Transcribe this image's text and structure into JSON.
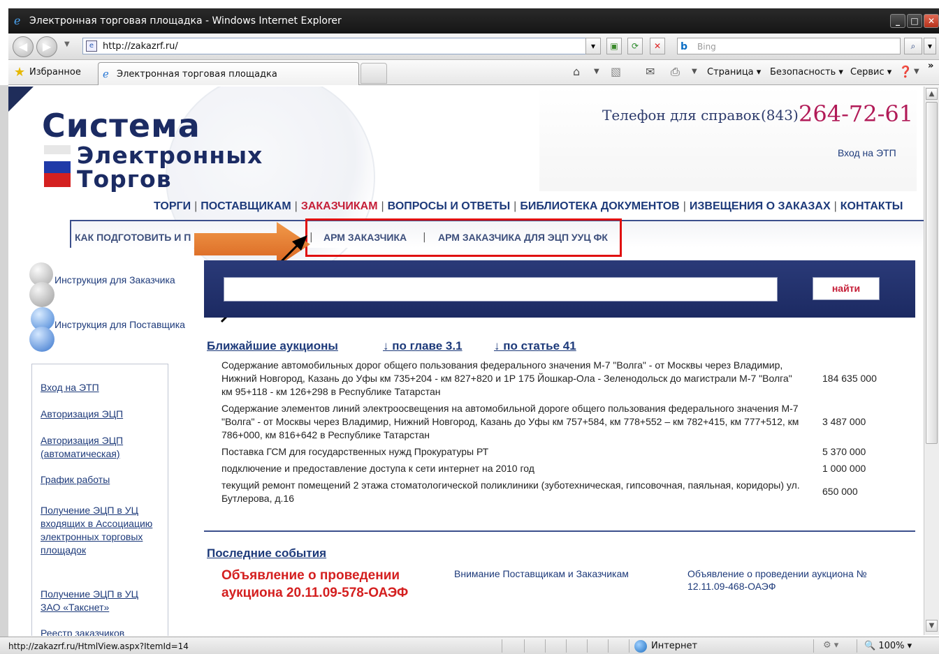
{
  "window": {
    "title": "Электронная торговая площадка - Windows Internet Explorer",
    "url": "http://zakazrf.ru/",
    "search_placeholder": "Bing",
    "search_logo": "b",
    "favorites_label": "Избранное",
    "tab_title": "Электронная торговая площадка",
    "commands": [
      "Страница",
      "Безопасность",
      "Сервис"
    ],
    "more": "»"
  },
  "header": {
    "logo_line1": "Система",
    "logo_line2": "Электронных",
    "logo_line3": "Торгов",
    "phone_label": "Телефон для справок",
    "phone_code": "(843)",
    "phone_number": "264-72-61",
    "login_link": "Вход на ЭТП"
  },
  "topnav": {
    "items": [
      "ТОРГИ",
      "ПОСТАВЩИКАМ",
      "ЗАКАЗЧИКАМ",
      "ВОПРОСЫ И ОТВЕТЫ",
      "БИБЛИОТЕКА ДОКУМЕНТОВ",
      "ИЗВЕЩЕНИЯ О ЗАКАЗАХ",
      "КОНТАКТЫ"
    ],
    "separator": "|",
    "active_index": 2
  },
  "subnav": {
    "items": [
      "КАК ПОДГОТОВИТЬ И П",
      "АРМ ЗАКАЗЧИКА",
      "АРМ ЗАКАЗЧИКА ДЛЯ ЭЦП УУЦ ФК"
    ],
    "separator": "|"
  },
  "instructions": [
    "Инструкция для Заказчика",
    "Инструкция для Поставщика"
  ],
  "search": {
    "value": "",
    "button": "найти"
  },
  "sidebar": {
    "links": [
      "Вход на ЭТП",
      "Авторизация ЭЦП",
      "Авторизация ЭЦП (автоматическая)",
      "График работы",
      "Получение ЭЦП в УЦ входящих в Ассоциацию электронных торговых площадок",
      "Получение ЭЦП в УЦ ЗАО «Такснет»",
      "Реестр заказчиков"
    ]
  },
  "auctions": {
    "tabs": [
      "Ближайшие аукционы",
      "↓ по главе 3.1",
      "↓ по статье 41"
    ],
    "rows": [
      {
        "text": "Содержание автомобильных дорог общего пользования федерального значения М-7 \"Волга\" - от Москвы через Владимир, Нижний Новгород, Казань до Уфы км 735+204 - км 827+820 и 1Р 175 Йошкар-Ола - Зеленодольск до магистрали М-7 \"Волга\" км 95+118 - км 126+298 в Республике Татарстан",
        "value": "184 635 000"
      },
      {
        "text": "Содержание элементов линий электроосвещения на автомобильной дороге общего пользования федерального значения М-7 \"Волга\" - от Москвы через Владимир, Нижний Новгород, Казань до Уфы км 757+584, км 778+552 – км 782+415, км 777+512, км 786+000, км 816+642 в Республике Татарстан",
        "value": "3 487 000"
      },
      {
        "text": "Поставка ГСМ для государственных нужд Прокуратуры РТ",
        "value": "5 370 000"
      },
      {
        "text": "подключение и предоставление доступа к сети интернет на 2010 год",
        "value": "1 000 000"
      },
      {
        "text": "текущий ремонт помещений 2 этажа стоматологической поликлиники (зуботехническая, гипсовочная, паяльная, коридоры) ул. Бутлерова, д.16",
        "value": "650 000"
      }
    ]
  },
  "events": {
    "title": "Последние события",
    "headline": "Объявление о проведении аукциона 20.11.09-578-ОАЭФ",
    "link1": "Внимание Поставщикам и Заказчикам",
    "link2": "Объявление о проведении аукциона № 12.11.09-468-ОАЭФ"
  },
  "statusbar": {
    "url": "http://zakazrf.ru/HtmlView.aspx?ItemId=14",
    "zone": "Интернет",
    "zoom": "100%"
  },
  "colors": {
    "brand_navy": "#1b2b63",
    "link_blue": "#1d3a7a",
    "active_red": "#c51f38",
    "phone_magenta": "#b11a57",
    "highlight_box": "#e01010",
    "annotation_arrow": "#e8762a"
  },
  "icons": [
    "ie-logo-icon",
    "back-icon",
    "forward-icon",
    "refresh-icon",
    "stop-icon",
    "search-icon",
    "star-icon",
    "home-icon",
    "rss-icon",
    "mail-icon",
    "print-icon",
    "help-icon",
    "globe-icon",
    "zoom-icon",
    "user-icon"
  ]
}
